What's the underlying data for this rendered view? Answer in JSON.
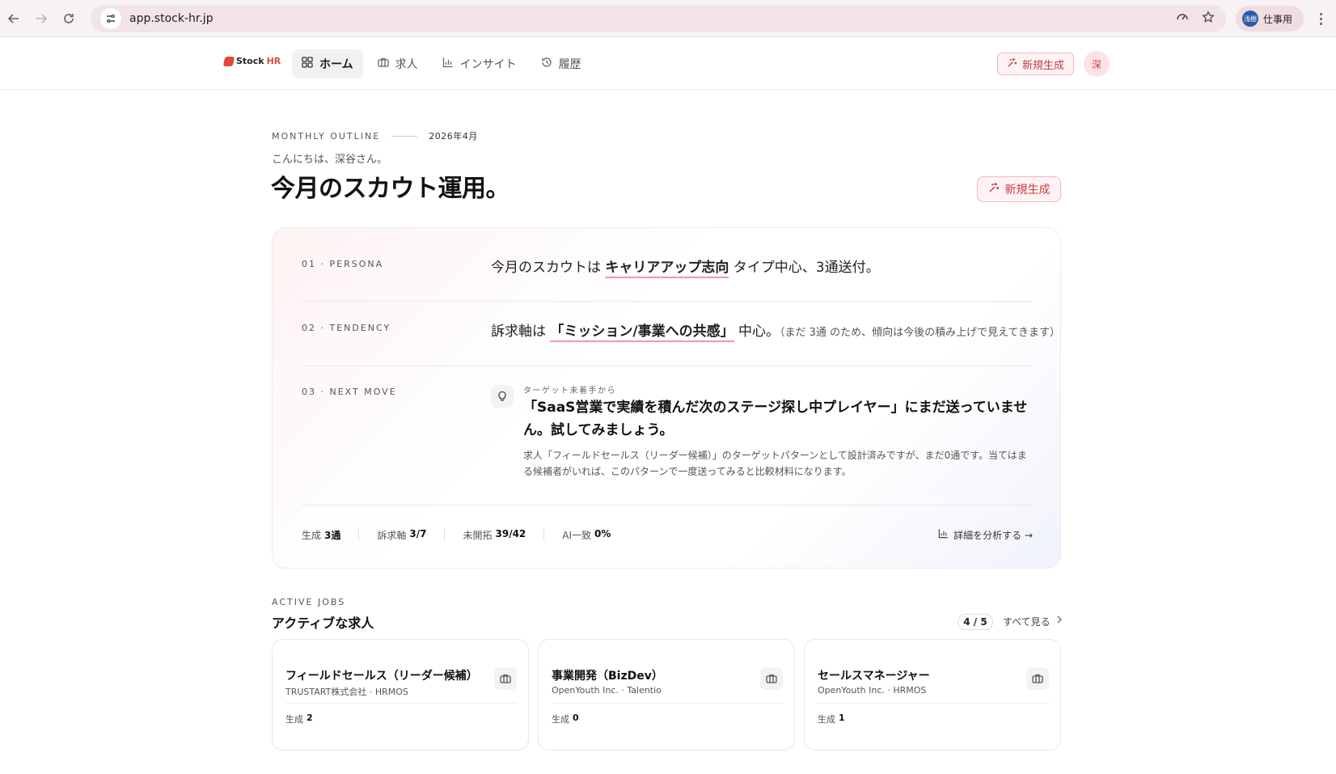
{
  "browser": {
    "url": "app.stock-hr.jp",
    "profile_badge": "浅樹",
    "profile_label": "仕事用"
  },
  "app": {
    "logo_text": "Stock",
    "logo_accent": "HR",
    "nav": [
      {
        "label": "ホーム",
        "icon": "grid-icon"
      },
      {
        "label": "求人",
        "icon": "briefcase-icon"
      },
      {
        "label": "インサイト",
        "icon": "bar-chart-icon"
      },
      {
        "label": "履歴",
        "icon": "history-icon"
      }
    ],
    "new_button_label": "新規生成",
    "avatar_initial": "深",
    "accent_color": "#c93a44"
  },
  "header": {
    "eyebrow": "MONTHLY OUTLINE",
    "month": "2026年4月",
    "greeting": "こんにちは、深谷さん。",
    "title": "今月のスカウト運用。",
    "new_button_label": "新規生成"
  },
  "outline": {
    "persona": {
      "label": "01 · PERSONA",
      "pre": "今月のスカウトは ",
      "highlight": "キャリアアップ志向",
      "post": " タイプ中心、3通送付。"
    },
    "tendency": {
      "label": "02 · TENDENCY",
      "pre": "訴求軸は ",
      "highlight": "「ミッション/事業への共感」",
      "post": " 中心。",
      "note": "（まだ 3通 のため、傾向は今後の積み上げで見えてきます）"
    },
    "next_move": {
      "label": "03 · NEXT MOVE",
      "kicker": "ターゲット未着手から",
      "headline": "「SaaS営業で実績を積んだ次のステージ探し中プレイヤー」にまだ送っていません。試してみましょう。",
      "body": "求人「フィールドセールス（リーダー候補）」のターゲットパターンとして設計済みですが、まだ0通です。当てはまる候補者がいれば、このパターンで一度送ってみると比較材料になります。"
    },
    "stats": [
      {
        "label": "生成",
        "value": "3通"
      },
      {
        "label": "訴求軸",
        "value": "3/7"
      },
      {
        "label": "未開拓",
        "value": "39/42"
      },
      {
        "label": "AI一致",
        "value": "0%"
      }
    ],
    "analyze_label": "詳細を分析する →"
  },
  "active_jobs": {
    "eyebrow": "ACTIVE JOBS",
    "title": "アクティブな求人",
    "count": "4 / 5",
    "see_all": "すべて見る",
    "jobs": [
      {
        "title": "フィールドセールス（リーダー候補）",
        "company": "TRUSTART株式会社 · HRMOS",
        "gen_label": "生成",
        "gen_value": "2"
      },
      {
        "title": "事業開発（BizDev）",
        "company": "OpenYouth Inc. · Talentio",
        "gen_label": "生成",
        "gen_value": "0"
      },
      {
        "title": "セールスマネージャー",
        "company": "OpenYouth Inc. · HRMOS",
        "gen_label": "生成",
        "gen_value": "1"
      }
    ]
  }
}
